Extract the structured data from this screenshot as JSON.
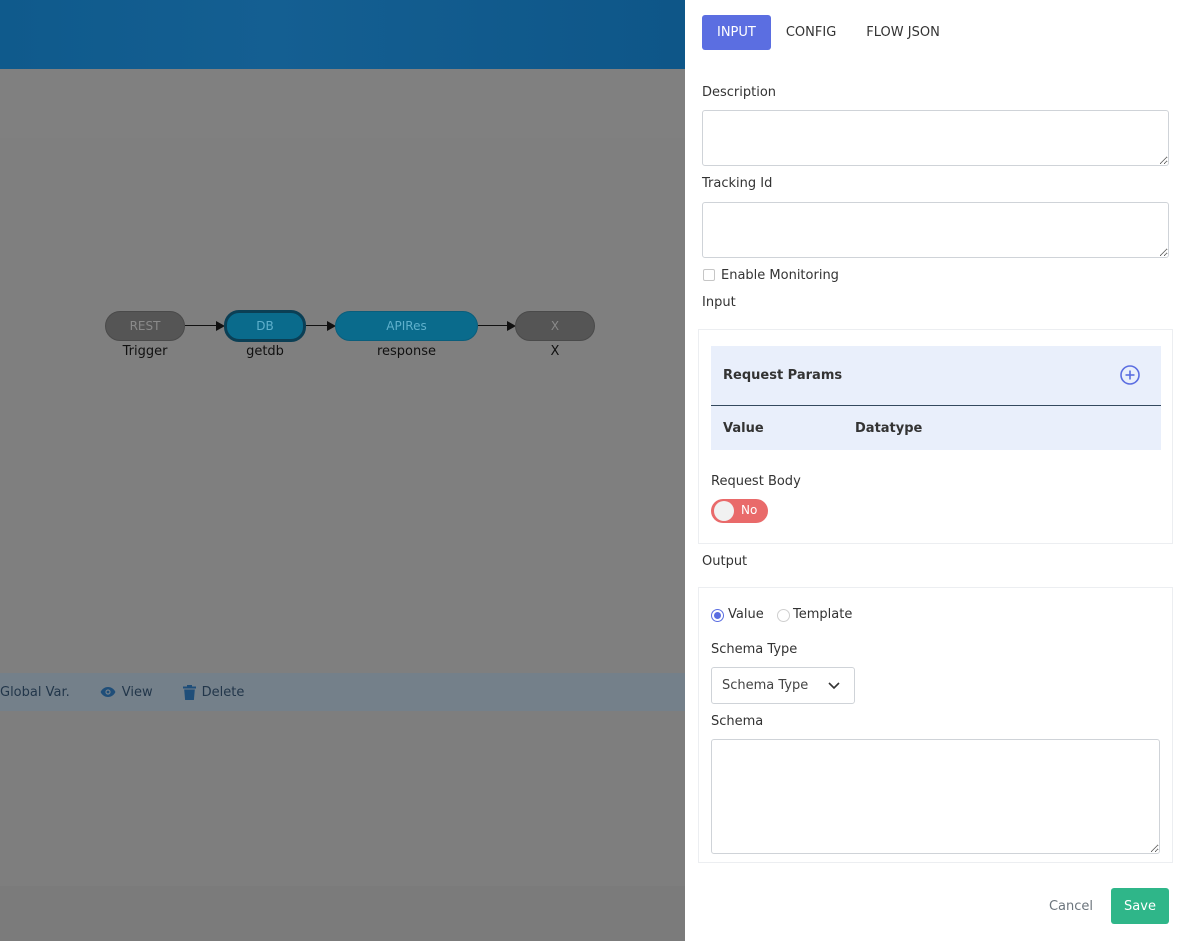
{
  "flow": {
    "nodes": [
      {
        "text": "REST",
        "label": "Trigger"
      },
      {
        "text": "DB",
        "label": "getdb"
      },
      {
        "text": "APIRes",
        "label": "response"
      },
      {
        "text": "X",
        "label": "X"
      }
    ],
    "toolbar": {
      "global_var": "Global Var.",
      "view": "View",
      "delete": "Delete"
    }
  },
  "panel": {
    "tabs": [
      "INPUT",
      "CONFIG",
      "FLOW JSON"
    ],
    "active_tab": "INPUT",
    "description_label": "Description",
    "description_value": "",
    "tracking_id_label": "Tracking Id",
    "tracking_id_value": "",
    "enable_monitoring_label": "Enable Monitoring",
    "enable_monitoring_checked": false,
    "input_label": "Input",
    "request_params": {
      "title": "Request Params",
      "columns": [
        "Value",
        "Datatype"
      ]
    },
    "request_body": {
      "label": "Request Body",
      "toggle_text": "No",
      "toggle_on": false
    },
    "output_label": "Output",
    "output_type_options": [
      "Value",
      "Template"
    ],
    "output_type_selected": "Value",
    "schema_type_label": "Schema Type",
    "schema_type_value": "Schema Type",
    "schema_label": "Schema",
    "schema_value": "",
    "cancel_label": "Cancel",
    "save_label": "Save"
  },
  "colors": {
    "primary": "#5b6ee1",
    "success": "#2fb689",
    "danger": "#e96a6a",
    "node_blue": "#0a6b8c",
    "header": "#0f5a8c"
  }
}
